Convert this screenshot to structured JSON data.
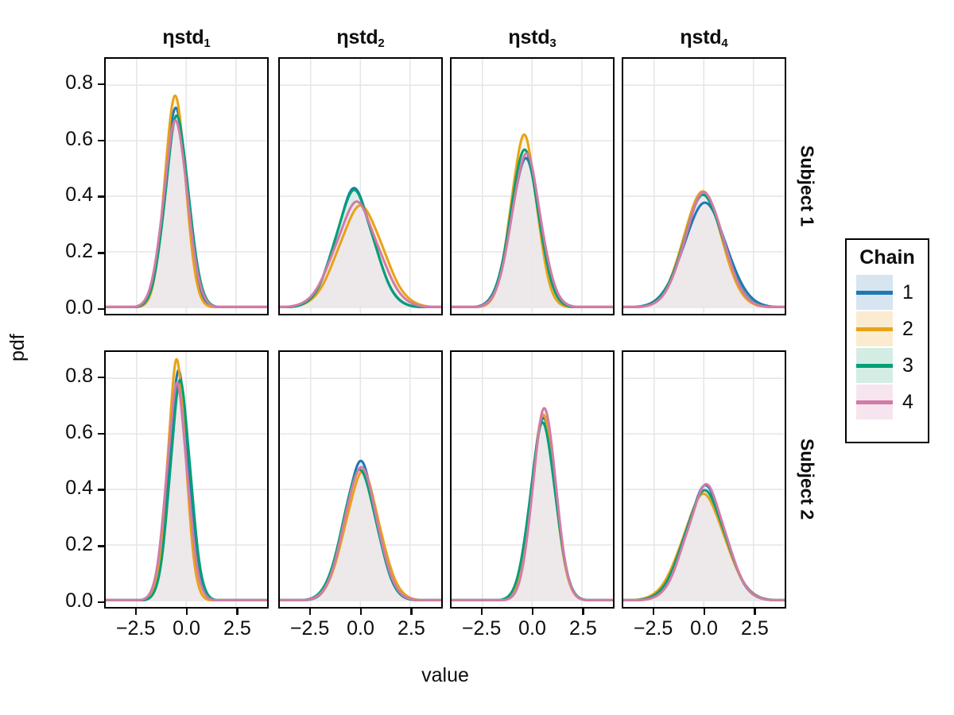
{
  "axis": {
    "y_title": "pdf",
    "x_title": "value",
    "y_ticks": [
      "0.0",
      "0.2",
      "0.4",
      "0.6",
      "0.8"
    ],
    "x_ticks": [
      "-2.5",
      "0.0",
      "2.5"
    ]
  },
  "legend": {
    "title": "Chain",
    "entries": [
      {
        "label": "1",
        "color": "#1F78B4",
        "fill": "#D6E5F0"
      },
      {
        "label": "2",
        "color": "#E8A317",
        "fill": "#FBEBD1"
      },
      {
        "label": "3",
        "color": "#00A077",
        "fill": "#D3EDE5"
      },
      {
        "label": "4",
        "color": "#D27BA8",
        "fill": "#F6E5EE"
      }
    ]
  },
  "col_strips": [
    {
      "base": "ηstd",
      "sub": "1"
    },
    {
      "base": "ηstd",
      "sub": "2"
    },
    {
      "base": "ηstd",
      "sub": "3"
    },
    {
      "base": "ηstd",
      "sub": "4"
    }
  ],
  "row_strips": [
    "Subject 1",
    "Subject 2"
  ],
  "chart_data": {
    "type": "line",
    "title": "",
    "xlabel": "value",
    "ylabel": "pdf",
    "xlim": [
      -4.05,
      4.05
    ],
    "ylim": [
      -0.022,
      0.895
    ],
    "grid": true,
    "legend_position": "right",
    "legend_title": "Chain",
    "facet_cols": [
      "ηstd1",
      "ηstd2",
      "ηstd3",
      "ηstd4"
    ],
    "facet_rows": [
      "Subject 1",
      "Subject 2"
    ],
    "xticks": [
      -2.5,
      0.0,
      2.5
    ],
    "yticks": [
      0.0,
      0.2,
      0.4,
      0.6,
      0.8
    ],
    "series_names": [
      "1",
      "2",
      "3",
      "4"
    ],
    "series_colors": [
      "#1F78B4",
      "#E8A317",
      "#00A077",
      "#D27BA8"
    ],
    "panels": [
      {
        "row": "Subject 1",
        "col": "ηstd1",
        "series": [
          {
            "name": "1",
            "mean": -0.52,
            "sd": 0.57,
            "peak": 0.7
          },
          {
            "name": "2",
            "mean": -0.56,
            "sd": 0.53,
            "peak": 0.752
          },
          {
            "name": "3",
            "mean": -0.47,
            "sd": 0.6,
            "peak": 0.668
          },
          {
            "name": "4",
            "mean": -0.54,
            "sd": 0.61,
            "peak": 0.652
          }
        ]
      },
      {
        "row": "Subject 1",
        "col": "ηstd2",
        "series": [
          {
            "name": "1",
            "mean": -0.3,
            "sd": 0.97,
            "peak": 0.412
          },
          {
            "name": "2",
            "mean": 0.02,
            "sd": 1.11,
            "peak": 0.358
          },
          {
            "name": "3",
            "mean": -0.3,
            "sd": 0.98,
            "peak": 0.405
          },
          {
            "name": "4",
            "mean": -0.18,
            "sd": 1.1,
            "peak": 0.362
          }
        ]
      },
      {
        "row": "Subject 1",
        "col": "ηstd3",
        "series": [
          {
            "name": "1",
            "mean": -0.34,
            "sd": 0.76,
            "peak": 0.518
          },
          {
            "name": "2",
            "mean": -0.42,
            "sd": 0.66,
            "peak": 0.601
          },
          {
            "name": "3",
            "mean": -0.38,
            "sd": 0.72,
            "peak": 0.545
          },
          {
            "name": "4",
            "mean": -0.3,
            "sd": 0.74,
            "peak": 0.532
          }
        ]
      },
      {
        "row": "Subject 1",
        "col": "ηstd4",
        "series": [
          {
            "name": "1",
            "mean": 0.06,
            "sd": 1.08,
            "peak": 0.368
          },
          {
            "name": "2",
            "mean": -0.06,
            "sd": 0.97,
            "peak": 0.41
          },
          {
            "name": "3",
            "mean": 0.0,
            "sd": 1.01,
            "peak": 0.395
          },
          {
            "name": "4",
            "mean": 0.02,
            "sd": 0.98,
            "peak": 0.406
          }
        ]
      },
      {
        "row": "Subject 2",
        "col": "ηstd1",
        "series": [
          {
            "name": "1",
            "mean": -0.38,
            "sd": 0.51,
            "peak": 0.78
          },
          {
            "name": "2",
            "mean": -0.48,
            "sd": 0.47,
            "peak": 0.832
          },
          {
            "name": "3",
            "mean": -0.3,
            "sd": 0.52,
            "peak": 0.763
          },
          {
            "name": "4",
            "mean": -0.46,
            "sd": 0.53,
            "peak": 0.748
          }
        ]
      },
      {
        "row": "Subject 2",
        "col": "ηstd2",
        "series": [
          {
            "name": "1",
            "mean": 0.0,
            "sd": 0.81,
            "peak": 0.487
          },
          {
            "name": "2",
            "mean": 0.1,
            "sd": 0.87,
            "peak": 0.452
          },
          {
            "name": "3",
            "mean": -0.04,
            "sd": 0.85,
            "peak": 0.462
          },
          {
            "name": "4",
            "mean": 0.02,
            "sd": 0.84,
            "peak": 0.468
          }
        ]
      },
      {
        "row": "Subject 2",
        "col": "ηstd3",
        "series": [
          {
            "name": "1",
            "mean": 0.58,
            "sd": 0.62,
            "peak": 0.64
          },
          {
            "name": "2",
            "mean": 0.56,
            "sd": 0.61,
            "peak": 0.65
          },
          {
            "name": "3",
            "mean": 0.54,
            "sd": 0.64,
            "peak": 0.622
          },
          {
            "name": "4",
            "mean": 0.62,
            "sd": 0.59,
            "peak": 0.672
          }
        ]
      },
      {
        "row": "Subject 2",
        "col": "ηstd4",
        "series": [
          {
            "name": "1",
            "mean": 0.08,
            "sd": 1.0,
            "peak": 0.398
          },
          {
            "name": "2",
            "mean": 0.0,
            "sd": 1.08,
            "peak": 0.368
          },
          {
            "name": "3",
            "mean": 0.06,
            "sd": 1.04,
            "peak": 0.383
          },
          {
            "name": "4",
            "mean": 0.12,
            "sd": 0.99,
            "peak": 0.402
          }
        ]
      }
    ]
  }
}
